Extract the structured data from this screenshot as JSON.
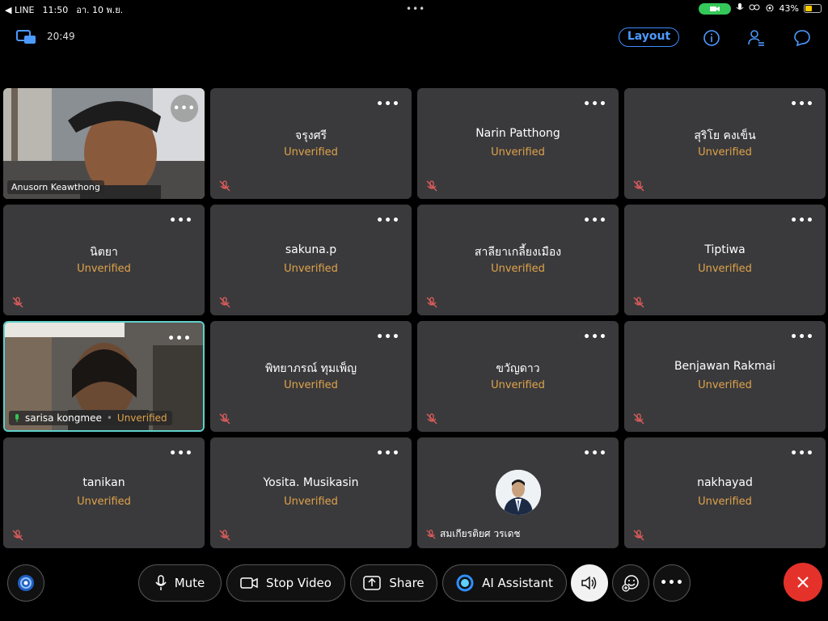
{
  "statusbar": {
    "back_app": "◀ LINE",
    "time": "11:50",
    "date": "อา. 10 พ.ย.",
    "battery": "43%"
  },
  "toolbar": {
    "timer": "20:49",
    "layout_label": "Layout"
  },
  "participants": [
    {
      "name": "Anusorn Keawthong",
      "status": "",
      "video": true
    },
    {
      "name": "จรุงศรี",
      "status": "Unverified"
    },
    {
      "name": "Narin Patthong",
      "status": "Unverified"
    },
    {
      "name": "สุริโย คงเข็น",
      "status": "Unverified"
    },
    {
      "name": "นิตยา",
      "status": "Unverified"
    },
    {
      "name": "sakuna.p",
      "status": "Unverified"
    },
    {
      "name": "สาลียาเกลี้ยงเมือง",
      "status": "Unverified"
    },
    {
      "name": "Tiptiwa",
      "status": "Unverified"
    },
    {
      "name": "sarisa kongmee",
      "status": "Unverified",
      "video": true,
      "active": true
    },
    {
      "name": "พิทยาภรณ์ ทุมเพ็ญ",
      "status": "Unverified"
    },
    {
      "name": "ขวัญดาว",
      "status": "Unverified"
    },
    {
      "name": "Benjawan Rakmai",
      "status": "Unverified"
    },
    {
      "name": "tanikan",
      "status": "Unverified"
    },
    {
      "name": "Yosita. Musikasin",
      "status": "Unverified"
    },
    {
      "name": "สมเกียรติยศ วรเดช",
      "status": "",
      "avatar": true
    },
    {
      "name": "nakhayad",
      "status": "Unverified"
    }
  ],
  "bottombar": {
    "mute_label": "Mute",
    "stop_video_label": "Stop Video",
    "share_label": "Share",
    "ai_label": "AI Assistant"
  },
  "colors": {
    "accent": "#3d8bff",
    "unverified": "#e0a34a",
    "leave": "#e4322b",
    "active_border": "#5fd0c9"
  }
}
